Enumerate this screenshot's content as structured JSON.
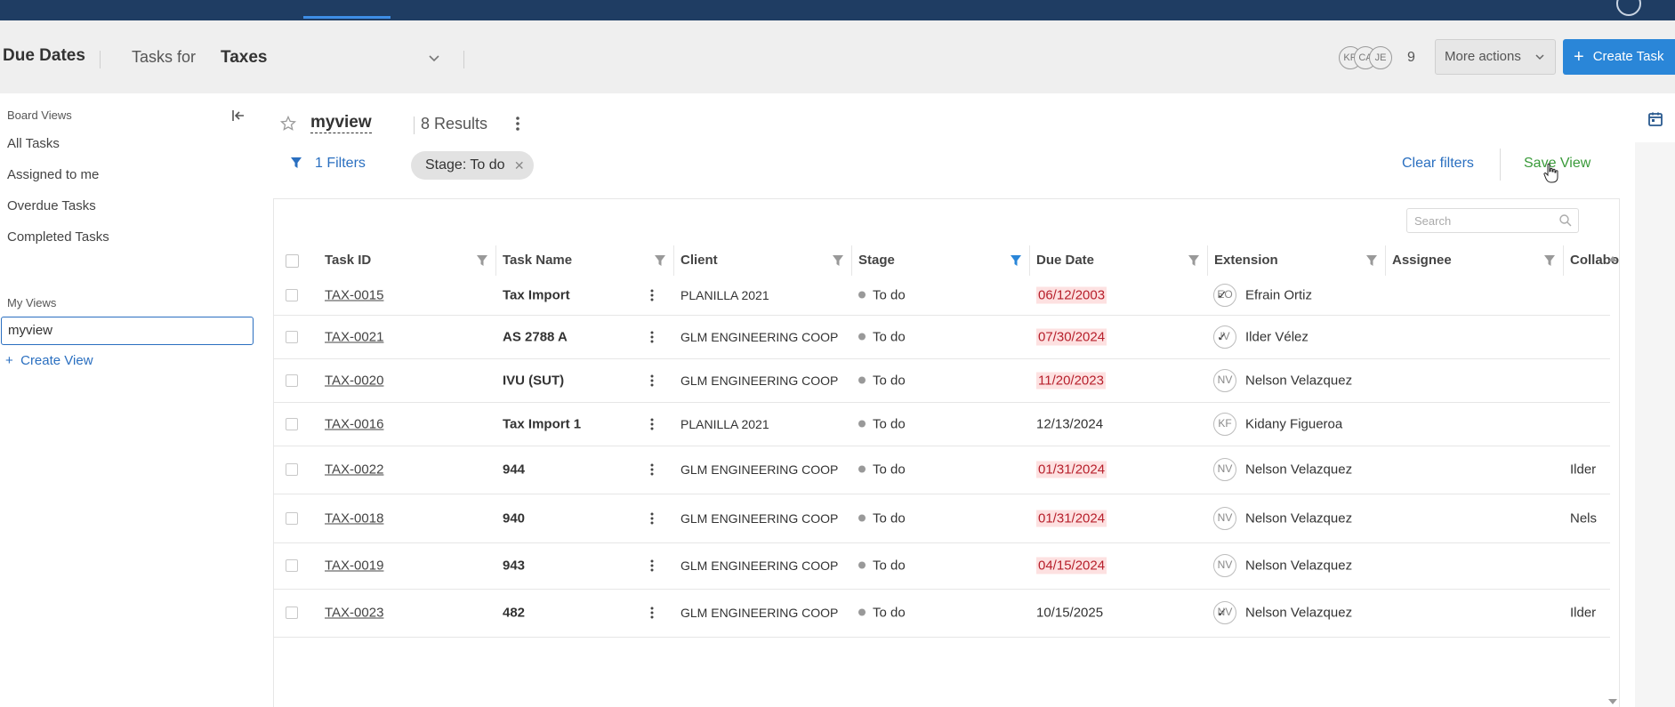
{
  "header": {
    "title": "Due Dates",
    "tasks_for_label": "Tasks for",
    "board_name": "Taxes",
    "collaborators": [
      "KR",
      "CA",
      "JE"
    ],
    "collaborator_count": "9",
    "more_actions_label": "More actions",
    "create_task_label": "Create Task"
  },
  "sidebar": {
    "board_views_heading": "Board Views",
    "board_views": [
      {
        "label": "All Tasks"
      },
      {
        "label": "Assigned to me"
      },
      {
        "label": "Overdue Tasks"
      },
      {
        "label": "Completed Tasks"
      }
    ],
    "my_views_heading": "My Views",
    "my_views": [
      {
        "label": "myview"
      }
    ],
    "create_view_label": "Create View"
  },
  "view": {
    "name": "myview",
    "results": "8 Results",
    "filters_label": "1 Filters",
    "filter_chip": "Stage: To do",
    "clear_filters_label": "Clear filters",
    "save_view_label": "Save View"
  },
  "table": {
    "search_placeholder": "Search",
    "columns": [
      "Task ID",
      "Task Name",
      "Client",
      "Stage",
      "Due Date",
      "Extension",
      "Assignee",
      "Collabo"
    ],
    "rows": [
      {
        "id": "TAX-0015",
        "name": "Tax Import",
        "client": "PLANILLA 2021",
        "stage": "To do",
        "due": "06/12/2003",
        "overdue": true,
        "extension": "✓",
        "assignee_initials": "EO",
        "assignee": "Efrain Ortiz",
        "collab": ""
      },
      {
        "id": "TAX-0021",
        "name": "AS 2788 A",
        "client": "GLM ENGINEERING COOP",
        "stage": "To do",
        "due": "07/30/2024",
        "overdue": true,
        "extension": "✓",
        "assignee_initials": "IV",
        "assignee": "Ilder Vélez",
        "collab": ""
      },
      {
        "id": "TAX-0020",
        "name": "IVU (SUT)",
        "client": "GLM ENGINEERING COOP",
        "stage": "To do",
        "due": "11/20/2023",
        "overdue": true,
        "extension": "",
        "assignee_initials": "NV",
        "assignee": "Nelson Velazquez",
        "collab": ""
      },
      {
        "id": "TAX-0016",
        "name": "Tax Import 1",
        "client": "PLANILLA 2021",
        "stage": "To do",
        "due": "12/13/2024",
        "overdue": false,
        "extension": "",
        "assignee_initials": "KF",
        "assignee": "Kidany Figueroa",
        "collab": ""
      },
      {
        "id": "TAX-0022",
        "name": "944",
        "client": "GLM ENGINEERING COOP",
        "stage": "To do",
        "due": "01/31/2024",
        "overdue": true,
        "extension": "",
        "assignee_initials": "NV",
        "assignee": "Nelson Velazquez",
        "collab": "Ilder"
      },
      {
        "id": "TAX-0018",
        "name": "940",
        "client": "GLM ENGINEERING COOP",
        "stage": "To do",
        "due": "01/31/2024",
        "overdue": true,
        "extension": "",
        "assignee_initials": "NV",
        "assignee": "Nelson Velazquez",
        "collab": "Nels"
      },
      {
        "id": "TAX-0019",
        "name": "943",
        "client": "GLM ENGINEERING COOP",
        "stage": "To do",
        "due": "04/15/2024",
        "overdue": true,
        "extension": "",
        "assignee_initials": "NV",
        "assignee": "Nelson Velazquez",
        "collab": ""
      },
      {
        "id": "TAX-0023",
        "name": "482",
        "client": "GLM ENGINEERING COOP",
        "stage": "To do",
        "due": "10/15/2025",
        "overdue": false,
        "extension": "✓",
        "assignee_initials": "NV",
        "assignee": "Nelson Velazquez",
        "collab": "Ilder"
      }
    ]
  },
  "colors": {
    "topbar": "#1f3d63",
    "primary": "#2a86d8",
    "save_green": "#3a9a3a",
    "overdue_bg": "#fde1e1",
    "overdue_text": "#b7202c"
  }
}
